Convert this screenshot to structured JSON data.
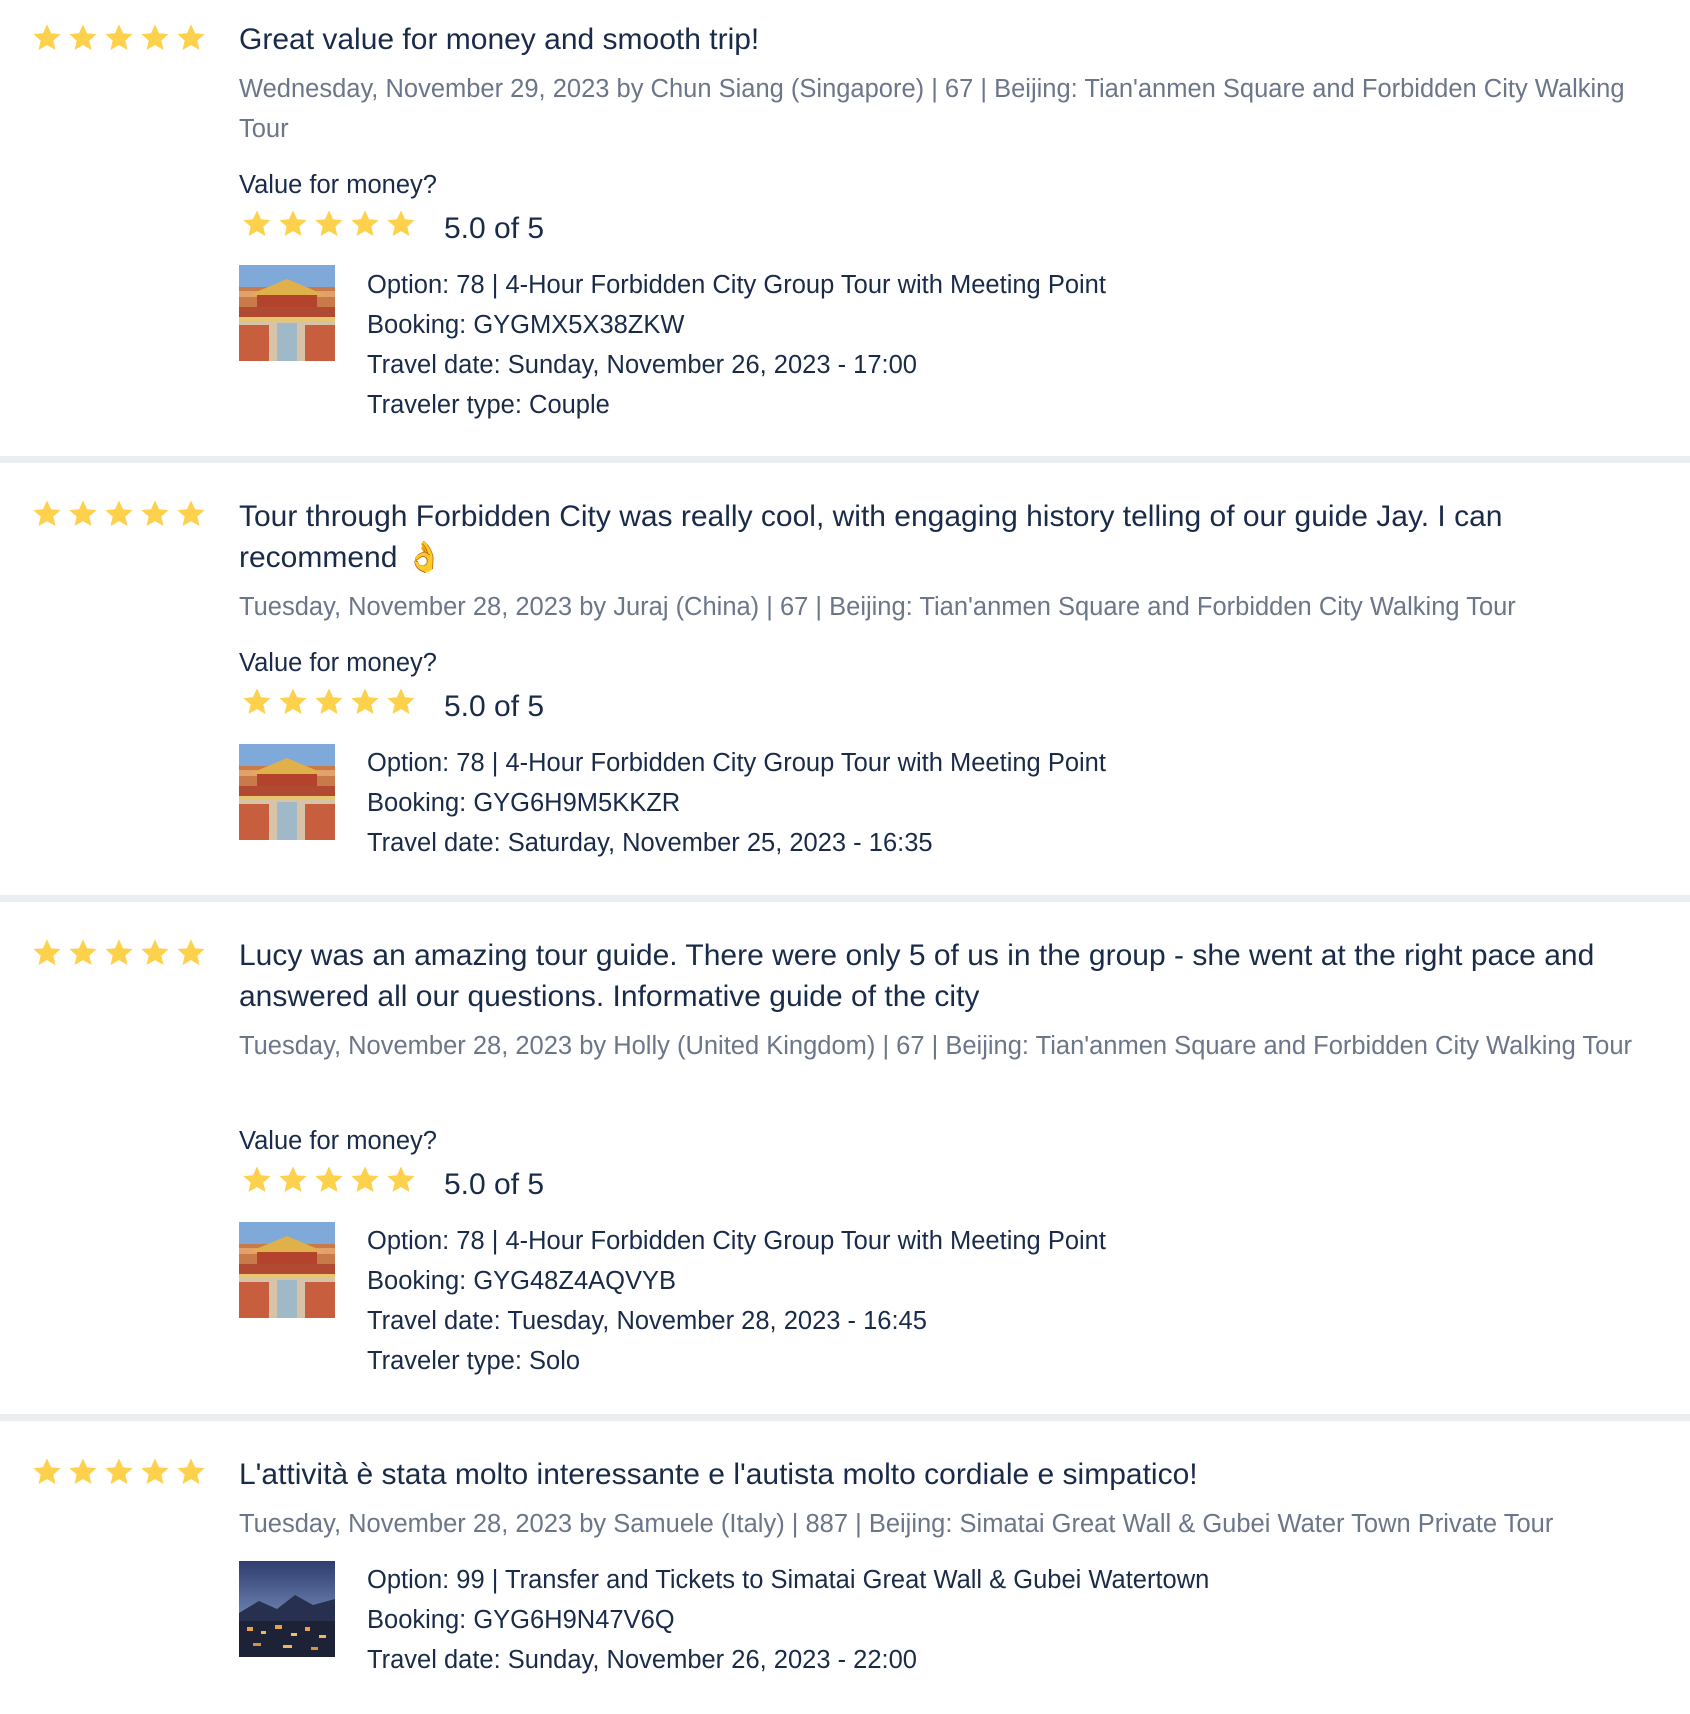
{
  "colors": {
    "star": "#fdd14b",
    "divider": "#ebeef1",
    "text_primary": "#1a2b49",
    "text_secondary": "#6c7689"
  },
  "reviews": [
    {
      "rating": 5,
      "title": "Great value for money and smooth trip!",
      "meta": "Wednesday, November 29, 2023 by Chun Siang (Singapore) | 67 | Beijing: Tian'anmen Square and Forbidden City Walking Tour",
      "value_label": "Value for money?",
      "value_rating": 5,
      "value_score": "5.0 of 5",
      "option": "Option: 78 | 4-Hour Forbidden City Group Tour with Meeting Point",
      "booking": "Booking: GYGMX5X38ZKW",
      "travel_date": "Travel date: Sunday, November 26, 2023 - 17:00",
      "traveler_type": "Traveler type: Couple",
      "thumbnail": "forbidden-city-photo"
    },
    {
      "rating": 5,
      "title": "Tour through Forbidden City was really cool, with engaging history telling of our guide Jay. I can recommend 👌",
      "meta": "Tuesday, November 28, 2023 by Juraj (China) | 67 | Beijing: Tian'anmen Square and Forbidden City Walking Tour",
      "value_label": "Value for money?",
      "value_rating": 5,
      "value_score": "5.0 of 5",
      "option": "Option: 78 | 4-Hour Forbidden City Group Tour with Meeting Point",
      "booking": "Booking: GYG6H9M5KKZR",
      "travel_date": "Travel date: Saturday, November 25, 2023 - 16:35",
      "thumbnail": "forbidden-city-photo"
    },
    {
      "rating": 5,
      "title": "Lucy was an amazing tour guide. There were only 5 of us in the group - she went at the right pace and answered all our questions. Informative guide of the city",
      "meta": "Tuesday, November 28, 2023 by Holly (United Kingdom) | 67 | Beijing: Tian'anmen Square and Forbidden City Walking Tour",
      "value_label": "Value for money?",
      "value_rating": 5,
      "value_score": "5.0 of 5",
      "option": "Option: 78 | 4-Hour Forbidden City Group Tour with Meeting Point",
      "booking": "Booking: GYG48Z4AQVYB",
      "travel_date": "Travel date: Tuesday, November 28, 2023 - 16:45",
      "traveler_type": "Traveler type: Solo",
      "thumbnail": "forbidden-city-photo"
    },
    {
      "rating": 5,
      "title": "L'attività è stata molto interessante e l'autista molto cordiale e simpatico!",
      "meta": "Tuesday, November 28, 2023 by Samuele (Italy) | 887 | Beijing: Simatai Great Wall & Gubei Water Town Private Tour",
      "option": "Option: 99 | Transfer and Tickets to Simatai Great Wall & Gubei Watertown",
      "booking": "Booking: GYG6H9N47V6Q",
      "travel_date": "Travel date: Sunday, November 26, 2023 - 22:00",
      "thumbnail": "gubei-night-photo"
    }
  ]
}
